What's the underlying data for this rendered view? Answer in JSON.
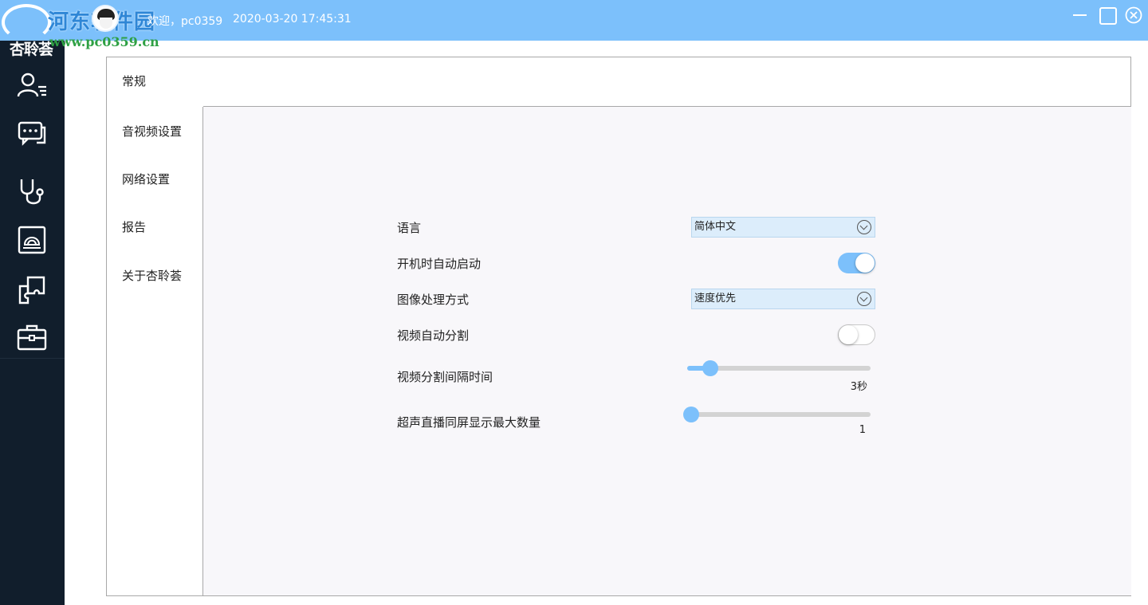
{
  "titlebar": {
    "logo_text": "杏聆荟",
    "watermark_title": "河东软件园",
    "watermark_url": "www.pc0359.cn",
    "greeting": "欢迎，pc0359",
    "datetime": "2020-03-20 17:45:31",
    "bg_color": "#7cc0fb"
  },
  "rail": {
    "bg_color": "#111e2c",
    "items": [
      {
        "icon": "contacts-icon"
      },
      {
        "icon": "chat-icon"
      },
      {
        "icon": "stethoscope-icon"
      },
      {
        "icon": "ultrasound-icon"
      },
      {
        "icon": "puzzle-icon"
      },
      {
        "icon": "toolbox-icon"
      }
    ]
  },
  "nav": {
    "items": [
      {
        "label": "常规",
        "active": true
      },
      {
        "label": "音视频设置",
        "active": false
      },
      {
        "label": "网络设置",
        "active": false
      },
      {
        "label": "报告",
        "active": false
      },
      {
        "label": "关于杏聆荟",
        "active": false
      }
    ]
  },
  "settings": {
    "language": {
      "label": "语言",
      "value": "简体中文"
    },
    "autostart": {
      "label": "开机时自动启动",
      "on": true
    },
    "image_processing": {
      "label": "图像处理方式",
      "value": "速度优先"
    },
    "video_split": {
      "label": "视频自动分割",
      "on": false
    },
    "split_interval": {
      "label": "视频分割间隔时间",
      "value_text": "3秒",
      "fraction": 0.08
    },
    "max_screens": {
      "label": "超声直播同屏显示最大数量",
      "value_text": "1",
      "fraction": 0.0
    }
  },
  "colors": {
    "accent": "#7cc0fb",
    "select_bg": "#dcedfb"
  }
}
